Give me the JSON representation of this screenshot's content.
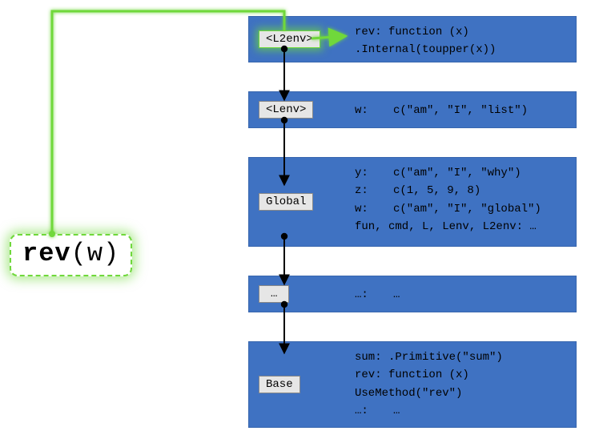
{
  "call": {
    "fn": "rev",
    "rest": "(w)"
  },
  "envs": {
    "l2": {
      "label": "<L2env>",
      "lines": {
        "a": "rev: function (x)",
        "b": "     .Internal(toupper(x))"
      }
    },
    "l": {
      "label": "<Lenv>",
      "lines": {
        "a_k": "w:",
        "a_v": "c(\"am\", \"I\", \"list\")"
      }
    },
    "global": {
      "label": "Global",
      "lines": {
        "a_k": "y:",
        "a_v": "c(\"am\", \"I\", \"why\")",
        "b_k": "z:",
        "b_v": "c(1, 5, 9, 8)",
        "c_k": "w:",
        "c_v": "c(\"am\", \"I\", \"global\")",
        "d": "fun, cmd, L, Lenv, L2env: …"
      }
    },
    "dots": {
      "label": "…",
      "lines": {
        "a_k": "…:",
        "a_v": "…"
      }
    },
    "base": {
      "label": "Base",
      "lines": {
        "a": "sum: .Primitive(\"sum\")",
        "b": "rev: function (x)",
        "c": "     UseMethod(\"rev\")",
        "d_k": "…:",
        "d_v": "…"
      }
    }
  }
}
